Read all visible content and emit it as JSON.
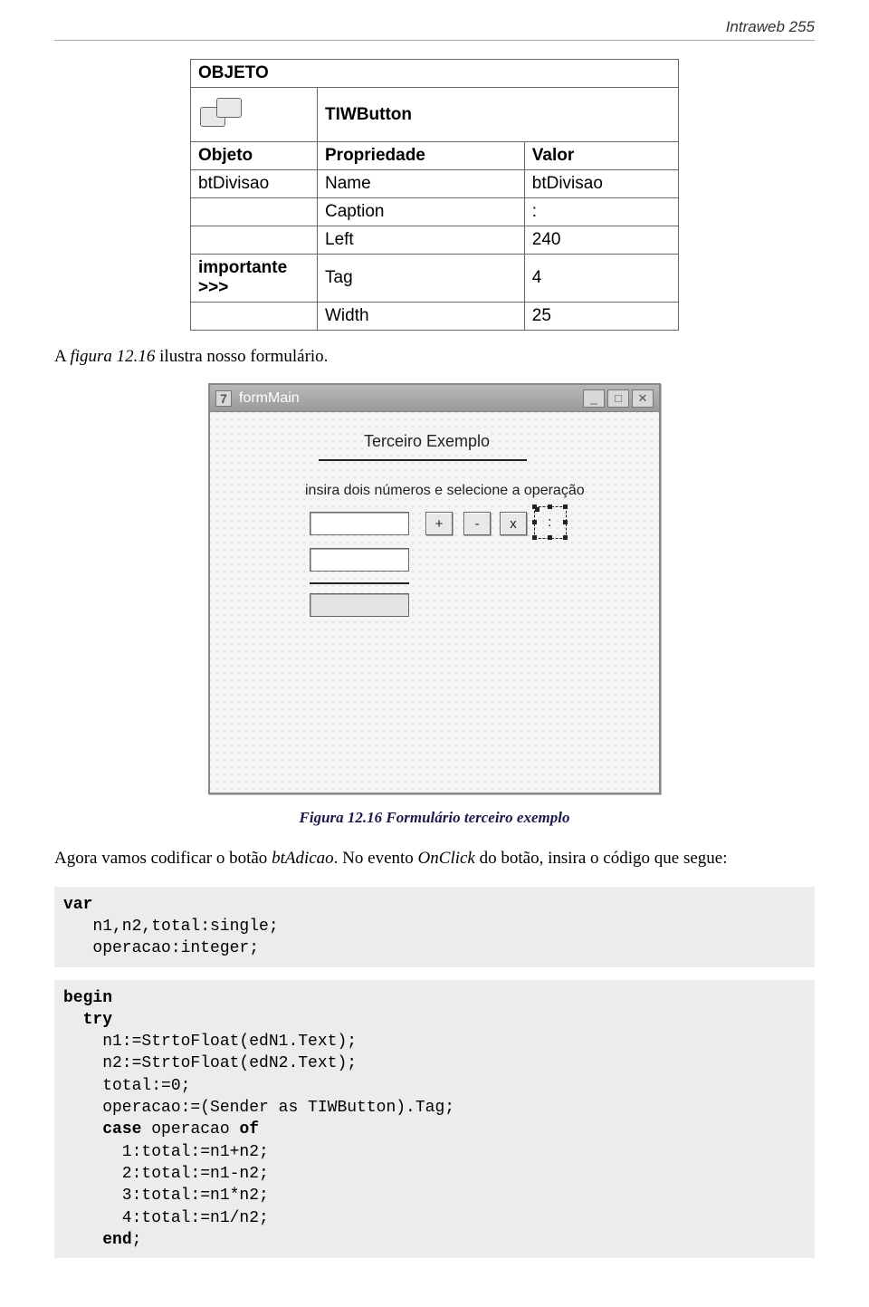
{
  "header": "Intraweb 255",
  "table": {
    "objeto_heading": "OBJETO",
    "component": "TIWButton",
    "cols": {
      "c1": "Objeto",
      "c2": "Propriedade",
      "c3": "Valor"
    },
    "rows": [
      {
        "c1": "btDivisao",
        "c2": "Name",
        "c3": "btDivisao"
      },
      {
        "c1": "",
        "c2": "Caption",
        "c3": ":"
      },
      {
        "c1": "",
        "c2": "Left",
        "c3": "240"
      },
      {
        "c1": "importante >>>",
        "c2": "Tag",
        "c3": "4"
      },
      {
        "c1": "",
        "c2": "Width",
        "c3": "25"
      }
    ]
  },
  "para1_prefix": "A ",
  "para1_fig": "figura 12.16",
  "para1_suffix": " ilustra nosso formulário.",
  "form": {
    "title": "formMain",
    "label_title": "Terceiro Exemplo",
    "label_instr": "insira dois números e selecione a operação",
    "op_plus": "+",
    "op_minus": "-",
    "op_mul": "x",
    "op_div": ":"
  },
  "fig_caption": "Figura 12.16 Formulário terceiro exemplo",
  "para2_a": "Agora vamos codificar o botão ",
  "para2_b": "btAdicao",
  "para2_c": ". No evento ",
  "para2_d": "OnClick",
  "para2_e": " do botão, insira o código que segue:",
  "code1_l1": "var",
  "code1_l2": "   n1,n2,total:single;",
  "code1_l3": "   operacao:integer;",
  "code2_l1": "begin",
  "code2_l2": "  try",
  "code2_l3": "    n1:=StrtoFloat(edN1.Text);",
  "code2_l4": "    n2:=StrtoFloat(edN2.Text);",
  "code2_l5": "    total:=0;",
  "code2_l6": "    operacao:=(Sender as TIWButton).Tag;",
  "code2_l7a": "    ",
  "code2_l7b": "case",
  "code2_l7c": " operacao ",
  "code2_l7d": "of",
  "code2_l8": "      1:total:=n1+n2;",
  "code2_l9": "      2:total:=n1-n2;",
  "code2_l10": "      3:total:=n1*n2;",
  "code2_l11": "      4:total:=n1/n2;",
  "code2_l12a": "    ",
  "code2_l12b": "end",
  "code2_l12c": ";"
}
